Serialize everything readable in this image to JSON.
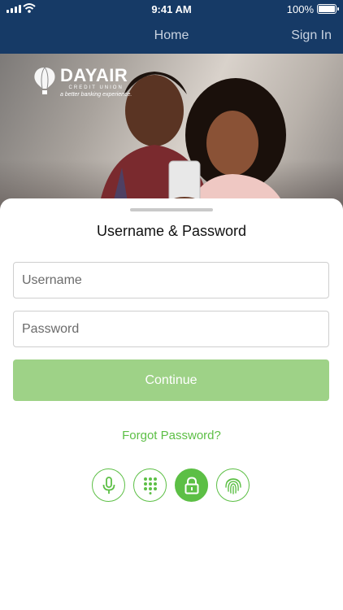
{
  "status_bar": {
    "time": "9:41 AM",
    "battery": "100%"
  },
  "nav": {
    "home": "Home",
    "sign_in": "Sign In"
  },
  "hero": {
    "brand": "DAYAIR",
    "brand_sub": "CREDIT UNION",
    "tagline": "a better banking experience."
  },
  "login": {
    "title": "Username & Password",
    "username_placeholder": "Username",
    "password_placeholder": "Password",
    "continue_label": "Continue",
    "forgot_label": "Forgot Password?"
  },
  "auth_methods": [
    "microphone-icon",
    "keypad-icon",
    "lock-icon",
    "fingerprint-icon"
  ],
  "colors": {
    "nav_bg": "#163a66",
    "accent": "#5cbf45",
    "button_disabled": "#9ed287"
  }
}
